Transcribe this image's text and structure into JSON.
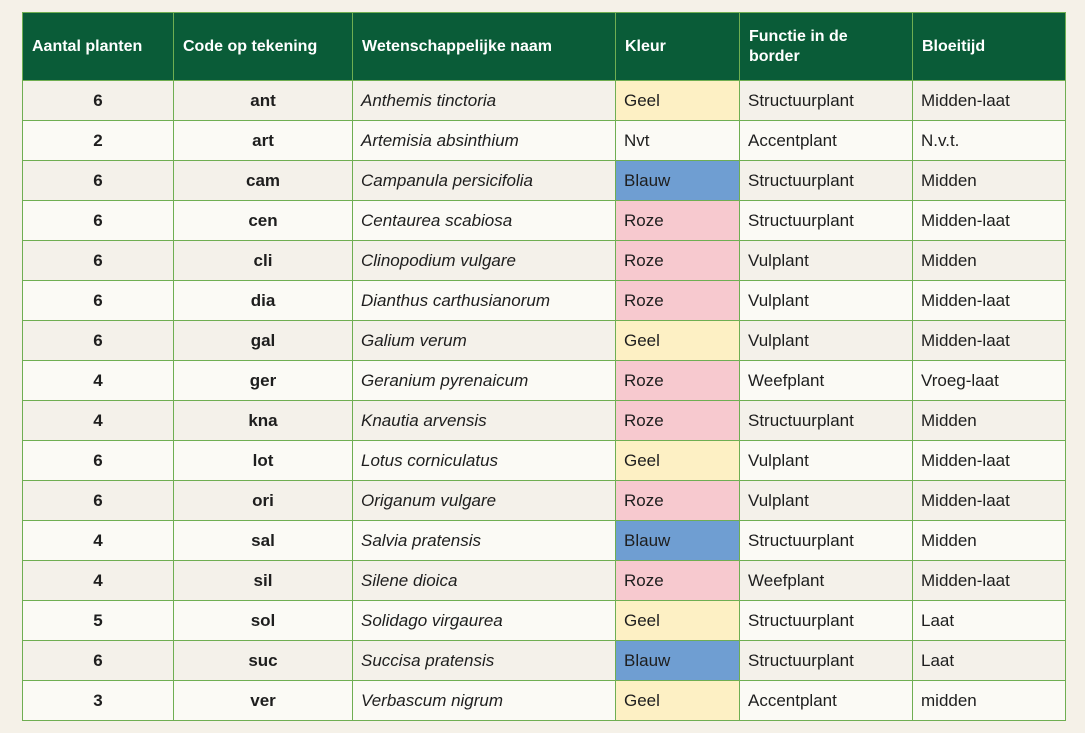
{
  "headers": [
    "Aantal planten",
    "Code op tekening",
    "Wetenschappelijke naam",
    "Kleur",
    "Functie in de border",
    "Bloeitijd"
  ],
  "colors": {
    "header_bg": "#0a5c38",
    "border": "#6fae52",
    "Geel": "#fdf0c4",
    "Roze": "#f7c9cf",
    "Blauw": "#6f9ed2"
  },
  "rows": [
    {
      "aantal": "6",
      "code": "ant",
      "naam": "Anthemis tinctoria",
      "kleur": "Geel",
      "functie": "Structuurplant",
      "bloeitijd": "Midden-laat"
    },
    {
      "aantal": "2",
      "code": "art",
      "naam": "Artemisia absinthium",
      "kleur": "Nvt",
      "functie": "Accentplant",
      "bloeitijd": "N.v.t."
    },
    {
      "aantal": "6",
      "code": "cam",
      "naam": "Campanula persicifolia",
      "kleur": "Blauw",
      "functie": "Structuurplant",
      "bloeitijd": "Midden"
    },
    {
      "aantal": "6",
      "code": "cen",
      "naam": "Centaurea scabiosa",
      "kleur": "Roze",
      "functie": "Structuurplant",
      "bloeitijd": "Midden-laat"
    },
    {
      "aantal": "6",
      "code": "cli",
      "naam": "Clinopodium vulgare",
      "kleur": "Roze",
      "functie": "Vulplant",
      "bloeitijd": "Midden"
    },
    {
      "aantal": "6",
      "code": "dia",
      "naam": "Dianthus carthusianorum",
      "kleur": "Roze",
      "functie": "Vulplant",
      "bloeitijd": "Midden-laat"
    },
    {
      "aantal": "6",
      "code": "gal",
      "naam": "Galium verum",
      "kleur": "Geel",
      "functie": "Vulplant",
      "bloeitijd": "Midden-laat"
    },
    {
      "aantal": "4",
      "code": "ger",
      "naam": "Geranium pyrenaicum",
      "kleur": "Roze",
      "functie": "Weefplant",
      "bloeitijd": "Vroeg-laat"
    },
    {
      "aantal": "4",
      "code": "kna",
      "naam": "Knautia arvensis",
      "kleur": "Roze",
      "functie": "Structuurplant",
      "bloeitijd": "Midden"
    },
    {
      "aantal": "6",
      "code": "lot",
      "naam": "Lotus corniculatus",
      "kleur": "Geel",
      "functie": "Vulplant",
      "bloeitijd": "Midden-laat"
    },
    {
      "aantal": "6",
      "code": "ori",
      "naam": "Origanum vulgare",
      "kleur": "Roze",
      "functie": "Vulplant",
      "bloeitijd": "Midden-laat"
    },
    {
      "aantal": "4",
      "code": "sal",
      "naam": "Salvia pratensis",
      "kleur": "Blauw",
      "functie": "Structuurplant",
      "bloeitijd": "Midden"
    },
    {
      "aantal": "4",
      "code": "sil",
      "naam": "Silene dioica",
      "kleur": "Roze",
      "functie": "Weefplant",
      "bloeitijd": "Midden-laat"
    },
    {
      "aantal": "5",
      "code": "sol",
      "naam": "Solidago virgaurea",
      "kleur": "Geel",
      "functie": "Structuurplant",
      "bloeitijd": "Laat"
    },
    {
      "aantal": "6",
      "code": "suc",
      "naam": "Succisa pratensis",
      "kleur": "Blauw",
      "functie": "Structuurplant",
      "bloeitijd": "Laat"
    },
    {
      "aantal": "3",
      "code": "ver",
      "naam": "Verbascum nigrum",
      "kleur": "Geel",
      "functie": "Accentplant",
      "bloeitijd": "midden"
    }
  ]
}
